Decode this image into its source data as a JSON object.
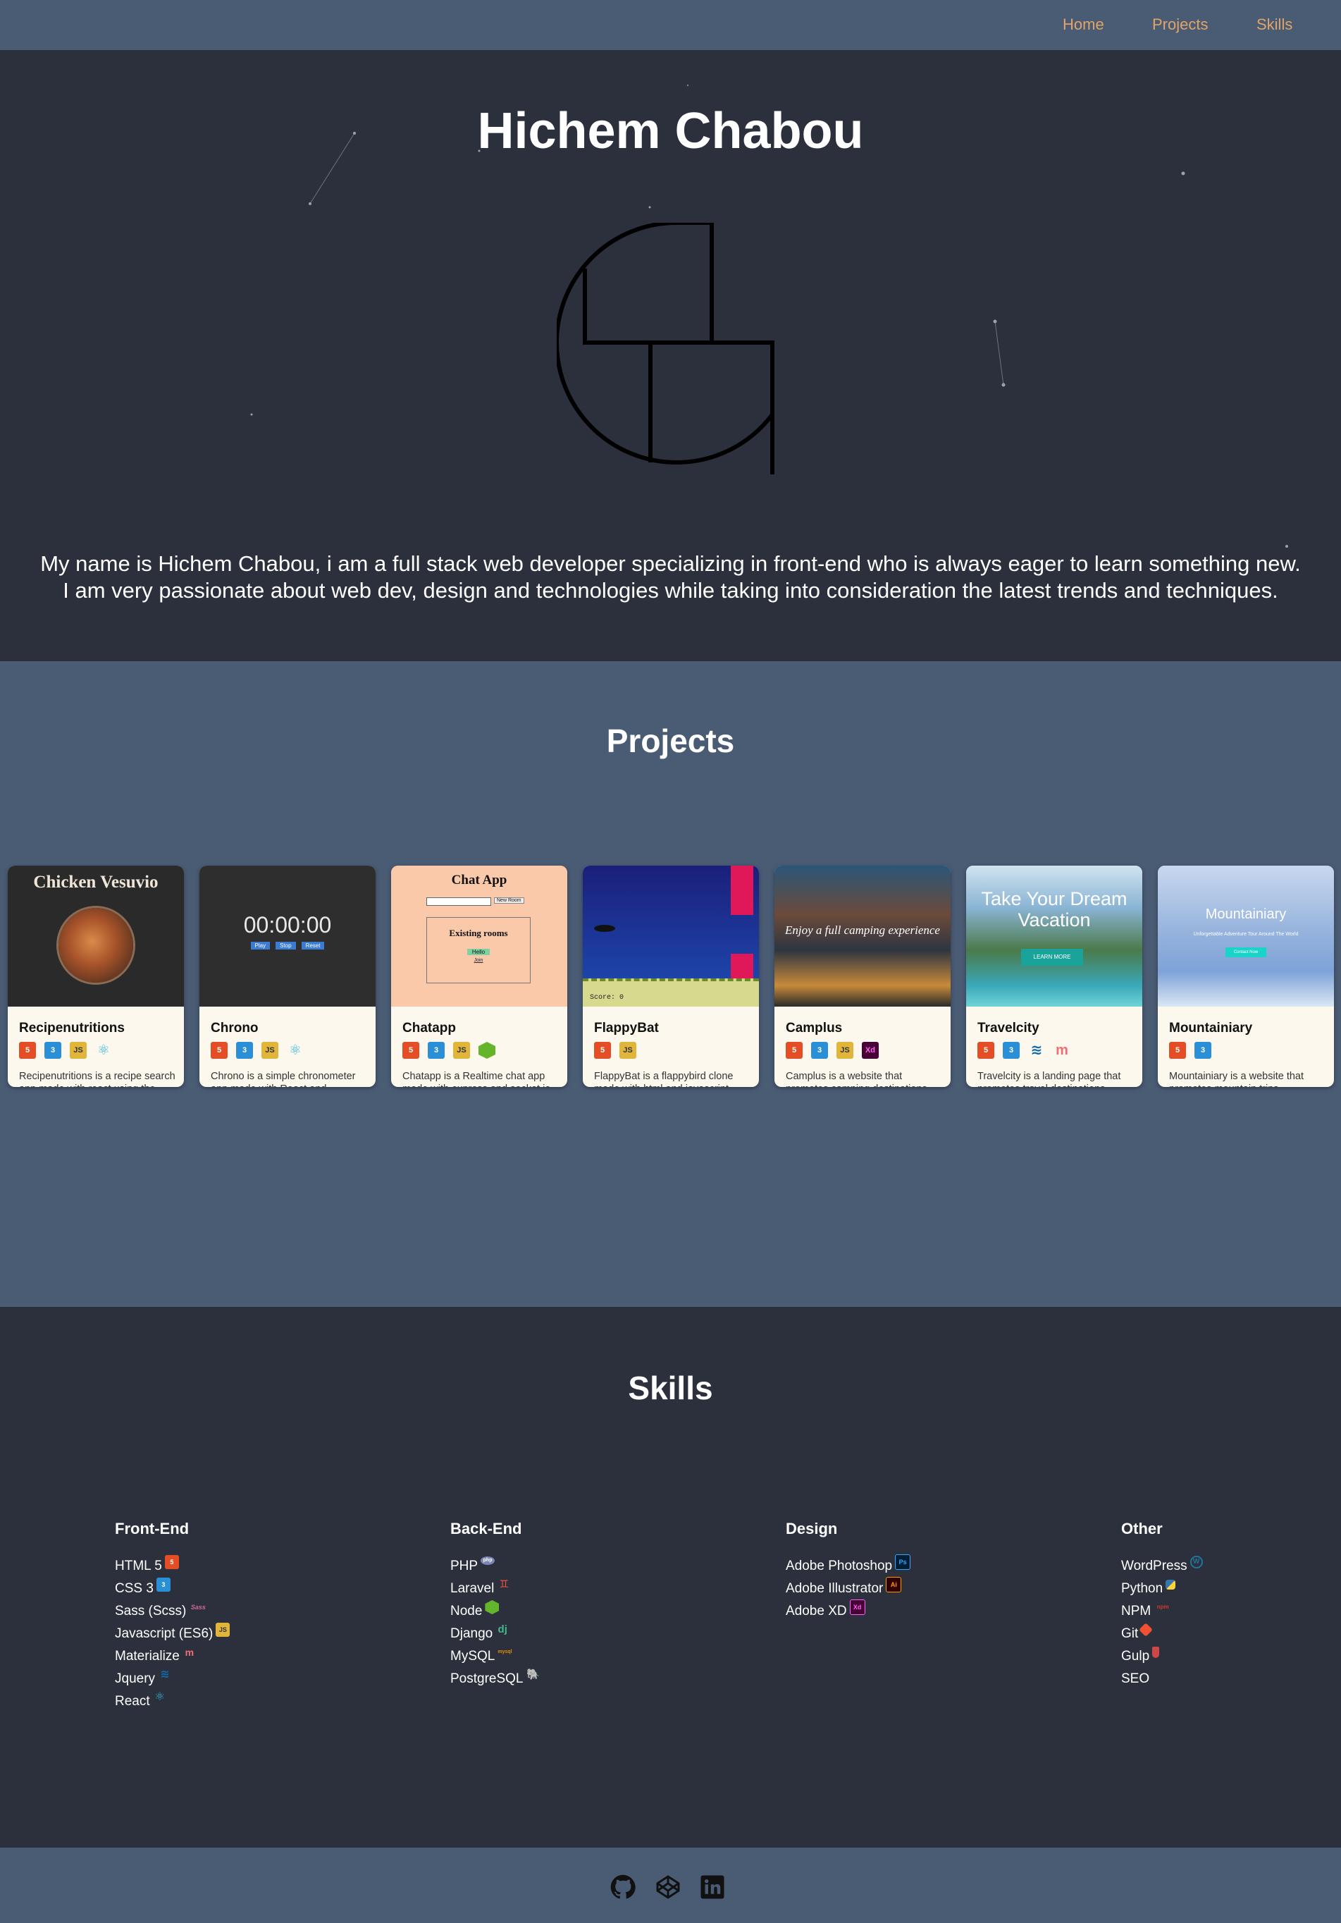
{
  "nav": {
    "items": [
      {
        "label": "Home"
      },
      {
        "label": "Projects"
      },
      {
        "label": "Skills"
      }
    ]
  },
  "hero": {
    "title": "Hichem Chabou",
    "intro_line1": "My name is Hichem Chabou, i am a full stack web developer specializing in front-end who is always eager to learn something new.",
    "intro_line2": "I am very passionate about web dev, design and technologies while taking into consideration the latest trends and techniques."
  },
  "projects": {
    "title": "Projects",
    "cards": [
      {
        "title": "Recipenutritions",
        "icons": [
          "html5-icon",
          "css3-icon",
          "javascript-icon",
          "react-icon"
        ],
        "desc": "Recipenutritions is a recipe search app made with react using the edamam api",
        "preview_text": "Chicken Vesuvio"
      },
      {
        "title": "Chrono",
        "icons": [
          "html5-icon",
          "css3-icon",
          "javascript-icon",
          "react-icon"
        ],
        "desc": "Chrono is a simple chronometer app made with React and Typescript",
        "preview_text": "00:00:00",
        "preview_buttons": [
          "Play",
          "Stop",
          "Reset"
        ]
      },
      {
        "title": "Chatapp",
        "icons": [
          "html5-icon",
          "css3-icon",
          "javascript-icon",
          "nodejs-icon"
        ],
        "desc": "Chatapp is a Realtime chat app made with express and socket.io",
        "preview_text": "Chat App",
        "preview_subtitle": "Existing rooms",
        "preview_button": "New Room",
        "preview_room1": "Hello",
        "preview_room2": "Join"
      },
      {
        "title": "FlappyBat",
        "icons": [
          "html5-icon",
          "javascript-icon"
        ],
        "desc": "FlappyBat is a flappybird clone made with html and javascript",
        "preview_text": "Score: 0"
      },
      {
        "title": "Camplus",
        "icons": [
          "html5-icon",
          "css3-icon",
          "javascript-icon",
          "adobe-xd-icon"
        ],
        "desc": "Camplus is a website that promotes camping destinations",
        "preview_text": "Enjoy a full camping experience"
      },
      {
        "title": "Travelcity",
        "icons": [
          "html5-icon",
          "css3-icon",
          "jquery-icon",
          "materialize-icon"
        ],
        "desc": "Travelcity is a landing page that promotes travel destinations",
        "preview_text": "Take Your Dream Vacation",
        "preview_button": "LEARN MORE"
      },
      {
        "title": "Mountainiary",
        "icons": [
          "html5-icon",
          "css3-icon"
        ],
        "desc": "Mountainiary is a website that promotes mountain trips",
        "preview_text": "Mountainiary",
        "preview_subtitle": "Unforgettable Adventure Tour Around The World",
        "preview_button": "Contact Now"
      }
    ]
  },
  "skills": {
    "title": "Skills",
    "columns": [
      {
        "heading": "Front-End",
        "items": [
          {
            "label": "HTML 5",
            "icon": "html5-icon"
          },
          {
            "label": "CSS 3",
            "icon": "css3-icon"
          },
          {
            "label": "Sass (Scss)",
            "icon": "sass-icon"
          },
          {
            "label": "Javascript (ES6)",
            "icon": "javascript-icon"
          },
          {
            "label": "Materialize",
            "icon": "materialize-icon"
          },
          {
            "label": "Jquery",
            "icon": "jquery-icon"
          },
          {
            "label": "React",
            "icon": "react-icon"
          }
        ]
      },
      {
        "heading": "Back-End",
        "items": [
          {
            "label": "PHP",
            "icon": "php-icon"
          },
          {
            "label": "Laravel",
            "icon": "laravel-icon"
          },
          {
            "label": "Node",
            "icon": "nodejs-icon"
          },
          {
            "label": "Django",
            "icon": "django-icon"
          },
          {
            "label": "MySQL",
            "icon": "mysql-icon"
          },
          {
            "label": "PostgreSQL",
            "icon": "postgresql-icon"
          }
        ]
      },
      {
        "heading": "Design",
        "items": [
          {
            "label": "Adobe Photoshop",
            "icon": "photoshop-icon"
          },
          {
            "label": "Adobe Illustrator",
            "icon": "illustrator-icon"
          },
          {
            "label": "Adobe XD",
            "icon": "adobe-xd-icon"
          }
        ]
      },
      {
        "heading": "Other",
        "items": [
          {
            "label": "WordPress",
            "icon": "wordpress-icon"
          },
          {
            "label": "Python",
            "icon": "python-icon"
          },
          {
            "label": "NPM",
            "icon": "npm-icon"
          },
          {
            "label": "Git",
            "icon": "git-icon"
          },
          {
            "label": "Gulp",
            "icon": "gulp-icon"
          },
          {
            "label": "SEO",
            "icon": ""
          }
        ]
      }
    ]
  },
  "footer": {
    "icons": [
      "github-icon",
      "codepen-icon",
      "linkedin-icon"
    ]
  },
  "colors": {
    "nav_bg": "#4a5b74",
    "dark_bg": "#2b303c",
    "accent": "#e0a46a",
    "card_bg": "#fdf8ee"
  }
}
